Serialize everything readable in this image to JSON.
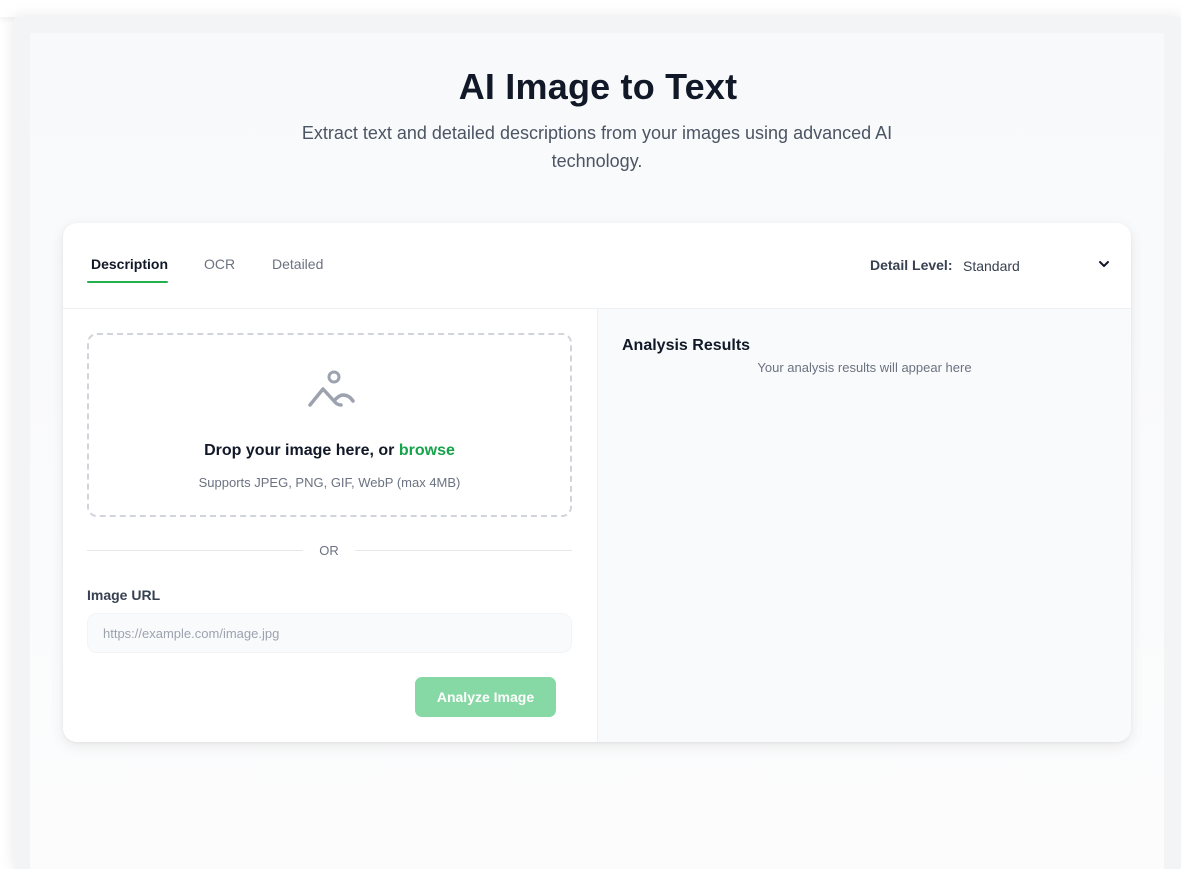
{
  "hero": {
    "title": "AI Image to Text",
    "subtitle": "Extract text and detailed descriptions from your images using advanced AI technology."
  },
  "tabs": [
    {
      "label": "Description",
      "active": true
    },
    {
      "label": "OCR",
      "active": false
    },
    {
      "label": "Detailed",
      "active": false
    }
  ],
  "detail_level": {
    "label": "Detail Level:",
    "selected": "Standard"
  },
  "upload": {
    "icon": "image-icon",
    "title_prefix": "Drop your image here, or ",
    "browse": "browse",
    "hint": "Supports JPEG, PNG, GIF, WebP (max 4MB)"
  },
  "divider": {
    "text": "OR"
  },
  "url": {
    "label": "Image URL",
    "placeholder": "https://example.com/image.jpg",
    "value": ""
  },
  "analyze_button": {
    "label": "Analyze Image",
    "enabled": false
  },
  "results": {
    "title": "Analysis Results",
    "empty_message": "Your analysis results will appear here"
  },
  "colors": {
    "accent": "#16a34a",
    "tab_underline": "#22b14c",
    "button_disabled": "#86d8a4",
    "text_primary": "#111827",
    "text_muted": "#6b7280"
  }
}
